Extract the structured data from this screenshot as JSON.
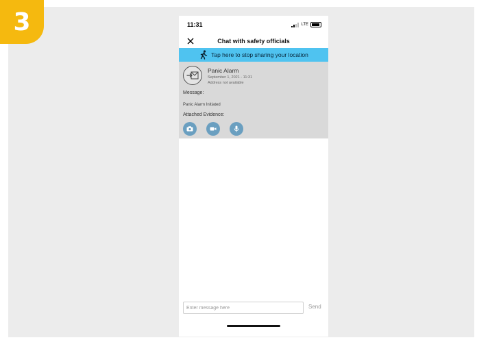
{
  "step_badge": {
    "number": "3",
    "color": "#f5b90f"
  },
  "status_bar": {
    "time": "11:31",
    "network": "LTE"
  },
  "nav": {
    "title": "Chat with safety officials",
    "close_icon": "close-icon"
  },
  "location_banner": {
    "text": "Tap here to stop sharing your location",
    "icon": "walking-person-icon",
    "color": "#4fc3f0"
  },
  "alarm": {
    "title": "Panic Alarm",
    "date": "September 1, 2021 - 11:31",
    "address": "Address not available",
    "icon": "envelope-arrow-icon",
    "message_label": "Message:",
    "message": "Panic Alarm Initiated",
    "evidence_label": "Attached Evidence:",
    "evidence_buttons": [
      {
        "icon": "camera-icon"
      },
      {
        "icon": "video-icon"
      },
      {
        "icon": "microphone-icon"
      }
    ]
  },
  "composer": {
    "placeholder": "Enter message here",
    "send_label": "Send"
  }
}
